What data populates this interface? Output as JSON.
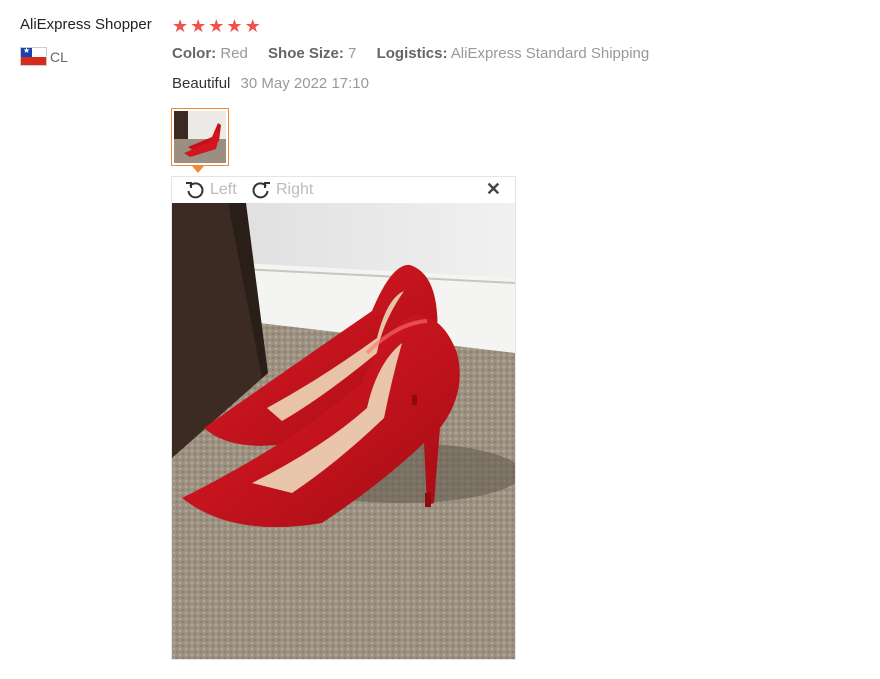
{
  "review": {
    "reviewer": "AliExpress Shopper",
    "rating": 5,
    "country_code": "CL",
    "attributes": [
      {
        "label": "Color:",
        "value": "Red"
      },
      {
        "label": "Shoe Size:",
        "value": "7"
      },
      {
        "label": "Logistics:",
        "value": "AliExpress Standard Shipping"
      }
    ],
    "feedback": "Beautiful",
    "date": "30 May 2022 17:10"
  },
  "viewer": {
    "rotate_left_label": "Left",
    "rotate_right_label": "Right",
    "close_symbol": "✕"
  },
  "icons": {
    "rotate_left": "rotate-left-icon",
    "rotate_right": "rotate-right-icon",
    "close": "close-icon",
    "star": "star-icon",
    "flag": "flag-chile-icon"
  },
  "colors": {
    "star": "#f0524b",
    "thumb_border": "#f38935",
    "muted_text": "#999999"
  }
}
